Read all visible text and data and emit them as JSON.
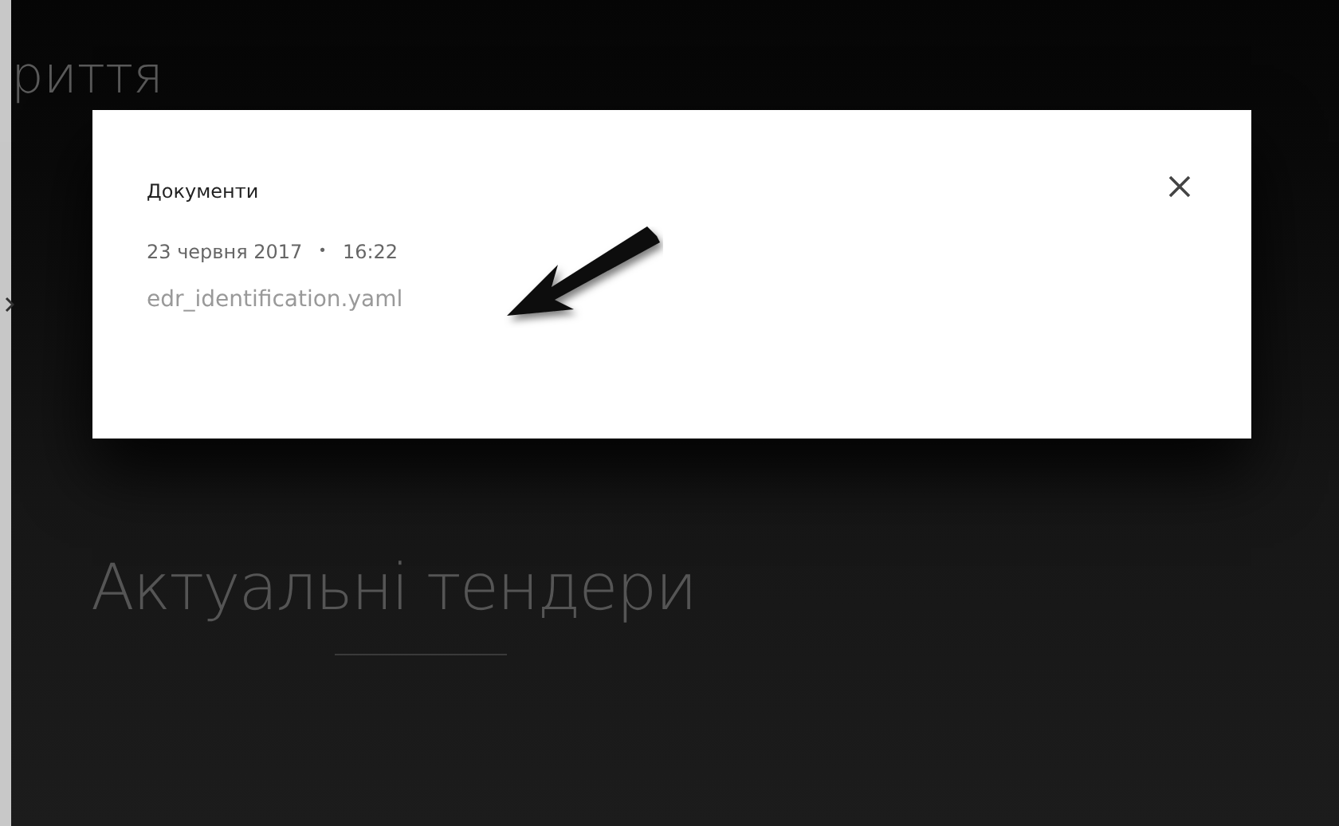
{
  "page": {
    "title_fragment": "риття",
    "heading": "Актуальні тендери"
  },
  "dialog": {
    "title": "Документи",
    "date": "23 червня 2017",
    "separator": "•",
    "time": "16:22",
    "file": "edr_identification.yaml"
  }
}
